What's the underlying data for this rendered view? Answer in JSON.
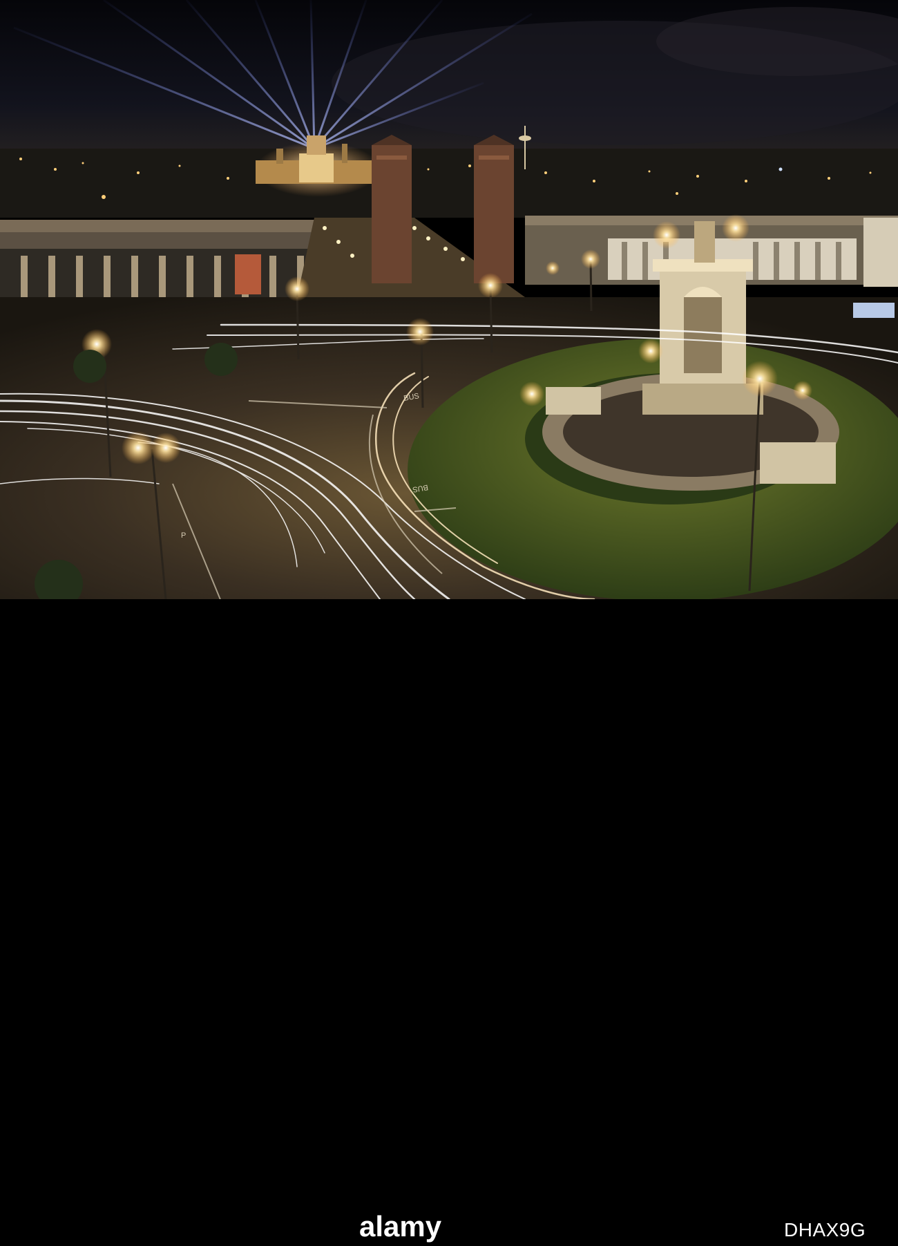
{
  "photo": {
    "subject": "night-long-exposure-city-roundabout-with-fountain",
    "palette": {
      "sky": "#0a0b12",
      "sky_glow": "#1b1c2c",
      "beam": "#8a9cff",
      "sodium_light": "#ffcf7a",
      "road": "#3b3327",
      "grass": "#3e5a1f",
      "stone": "#c9b99a",
      "trail": "#ffffff"
    }
  },
  "road_markings": {
    "bus_lane_left": "BUS",
    "bus_lane_right": "BUS",
    "parking": "P"
  },
  "watermark": {
    "brand": "alamy",
    "stock_id": "DHAX9G"
  }
}
